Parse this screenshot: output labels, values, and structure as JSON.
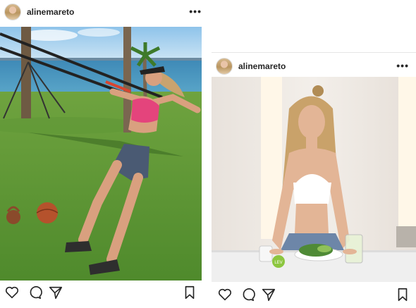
{
  "posts": [
    {
      "username": "alinemareto",
      "more_label": "•••"
    },
    {
      "username": "alinemareto",
      "more_label": "•••",
      "cup_label": "LEV"
    }
  ],
  "icons": [
    "heart-icon",
    "comment-icon",
    "share-icon",
    "bookmark-icon",
    "more-icon"
  ]
}
